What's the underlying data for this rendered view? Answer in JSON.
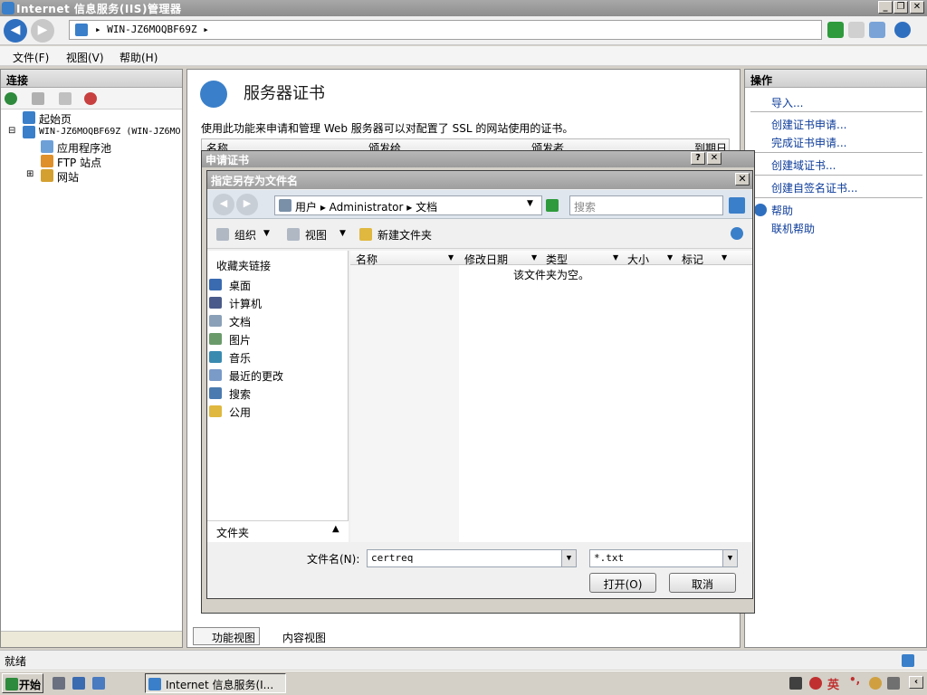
{
  "window": {
    "title": "Internet 信息服务(IIS)管理器"
  },
  "address": {
    "path": "WIN-JZ6MOQBF69Z"
  },
  "menu": [
    "文件(F)",
    "视图(V)",
    "帮助(H)"
  ],
  "connections": {
    "header": "连接",
    "tree": {
      "start_page": "起始页",
      "server": "WIN-JZ6MOQBF69Z (WIN-JZ6MO",
      "app_pools": "应用程序池",
      "ftp_sites": "FTP 站点",
      "sites": "网站"
    }
  },
  "main": {
    "title": "服务器证书",
    "description": "使用此功能来申请和管理 Web 服务器可以对配置了 SSL 的网站使用的证书。",
    "columns": [
      "名称",
      "颁发给",
      "颁发者",
      "到期日"
    ],
    "views": {
      "features": "功能视图",
      "content": "内容视图"
    }
  },
  "actions": {
    "header": "操作",
    "items": [
      "导入...",
      "创建证书申请...",
      "完成证书申请...",
      "创建域证书...",
      "创建自签名证书...",
      "帮助",
      "联机帮助"
    ]
  },
  "status": {
    "text": "就绪"
  },
  "request_dialog": {
    "title": "申请证书"
  },
  "save_dialog": {
    "title": "指定另存为文件名",
    "breadcrumb": "用户 ▸ Administrator ▸ 文档",
    "search_placeholder": "搜索",
    "toolbar": {
      "organize": "组织",
      "views": "视图",
      "new_folder": "新建文件夹"
    },
    "favorites_header": "收藏夹链接",
    "favorites": [
      "桌面",
      "计算机",
      "文档",
      "图片",
      "音乐",
      "最近的更改",
      "搜索",
      "公用"
    ],
    "folders_label": "文件夹",
    "columns": [
      "名称",
      "修改日期",
      "类型",
      "大小",
      "标记"
    ],
    "empty_text": "该文件夹为空。",
    "filename_label": "文件名(N):",
    "filename": "certreq",
    "filetype": "*.txt",
    "open_button": "打开(O)",
    "cancel_button": "取消"
  },
  "taskbar": {
    "start": "开始",
    "task": "Internet 信息服务(I...",
    "ime": "英"
  },
  "colors": {
    "accent": "#3a7fc9",
    "link": "#0d3c9a"
  }
}
